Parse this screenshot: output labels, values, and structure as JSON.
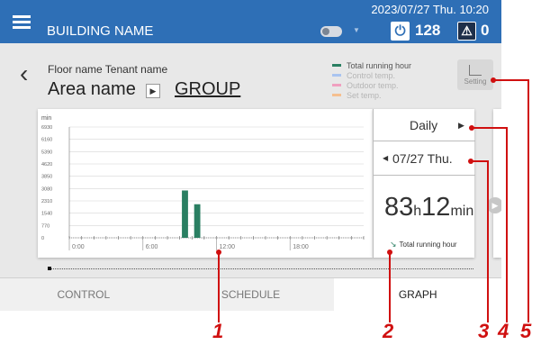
{
  "header": {
    "building_name": "BUILDING NAME",
    "datetime": "2023/07/27 Thu. 10:20",
    "running_count": "128",
    "alarm_count": "0",
    "power_icon": "power-icon",
    "alarm_icon": "warning-triangle-icon"
  },
  "subheader": {
    "floor_tenant": "Floor name Tenant name",
    "area_name": "Area name",
    "group_link": "GROUP"
  },
  "legend": [
    {
      "label": "Total running hour",
      "color": "#2a7f62",
      "active": true
    },
    {
      "label": "Control temp.",
      "color": "#a9c4f0",
      "active": false
    },
    {
      "label": "Outdoor temp.",
      "color": "#f0a0c0",
      "active": false
    },
    {
      "label": "Set temp.",
      "color": "#f5c090",
      "active": false
    }
  ],
  "setting_button": {
    "label": "Setting"
  },
  "graph_panel": {
    "period": "Daily",
    "date": "07/27 Thu.",
    "total_hours": "83",
    "hours_unit": "h",
    "total_minutes": "12",
    "minutes_unit": "min",
    "total_label": "Total running hour"
  },
  "tabs": [
    {
      "label": "CONTROL",
      "active": false
    },
    {
      "label": "SCHEDULE",
      "active": false
    },
    {
      "label": "GRAPH",
      "active": true
    }
  ],
  "callouts": [
    "1",
    "2",
    "3",
    "4",
    "5"
  ],
  "chart_data": {
    "type": "bar",
    "title": "",
    "xlabel": "",
    "ylabel": "min",
    "ylim": [
      0,
      6930
    ],
    "y_ticks": [
      "6930",
      "6160",
      "5390",
      "4620",
      "3850",
      "3080",
      "2310",
      "1540",
      "770",
      "0"
    ],
    "x_ticks": [
      "0:00",
      "6:00",
      "12:00",
      "18:00"
    ],
    "categories": [
      "0:00",
      "1:00",
      "2:00",
      "3:00",
      "4:00",
      "5:00",
      "6:00",
      "7:00",
      "8:00",
      "9:00",
      "10:00",
      "11:00",
      "12:00",
      "13:00",
      "14:00",
      "15:00",
      "16:00",
      "17:00",
      "18:00",
      "19:00",
      "20:00",
      "21:00",
      "22:00",
      "23:00"
    ],
    "series": [
      {
        "name": "Total running hour",
        "color": "#2a7f62",
        "values": [
          0,
          0,
          0,
          0,
          0,
          0,
          0,
          0,
          0,
          2960,
          2100,
          0,
          0,
          0,
          0,
          0,
          0,
          0,
          0,
          0,
          0,
          0,
          0,
          0
        ]
      }
    ],
    "grid": true
  }
}
